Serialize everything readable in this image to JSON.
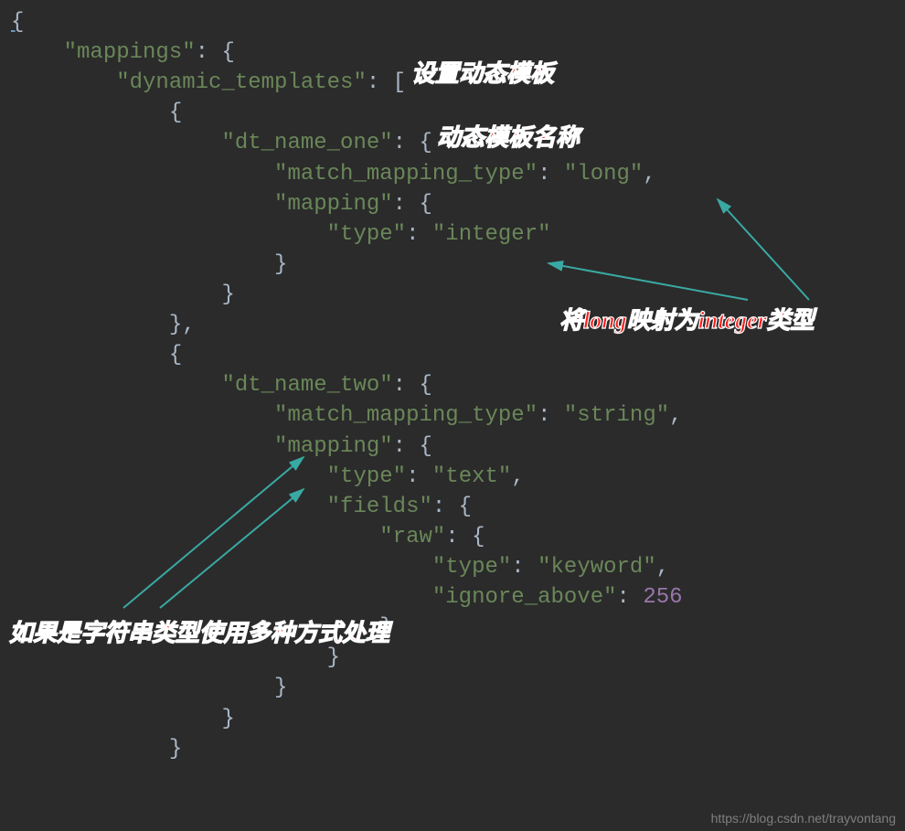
{
  "code": {
    "l1_open": "{",
    "l2_mappings": "\"mappings\"",
    "l3_dyn": "\"dynamic_templates\"",
    "l5_dt1": "\"dt_name_one\"",
    "l6_mmt": "\"match_mapping_type\"",
    "l6_long": "\"long\"",
    "l7_mapping": "\"mapping\"",
    "l8_type": "\"type\"",
    "l8_integer": "\"integer\"",
    "l13_dt2": "\"dt_name_two\"",
    "l14_mmt": "\"match_mapping_type\"",
    "l14_string": "\"string\"",
    "l15_mapping": "\"mapping\"",
    "l16_type": "\"type\"",
    "l16_text": "\"text\"",
    "l17_fields": "\"fields\"",
    "l18_raw": "\"raw\"",
    "l19_type": "\"type\"",
    "l19_keyword": "\"keyword\"",
    "l20_ignore": "\"ignore_above\"",
    "l20_val": "256"
  },
  "annotations": {
    "a1": "设置动态模板",
    "a2": "动态模板名称",
    "a3": "将long映射为integer类型",
    "a4": "如果是字符串类型使用多种方式处理"
  },
  "watermark": "https://blog.csdn.net/trayvontang",
  "arrow_color": "#3aa9a4"
}
